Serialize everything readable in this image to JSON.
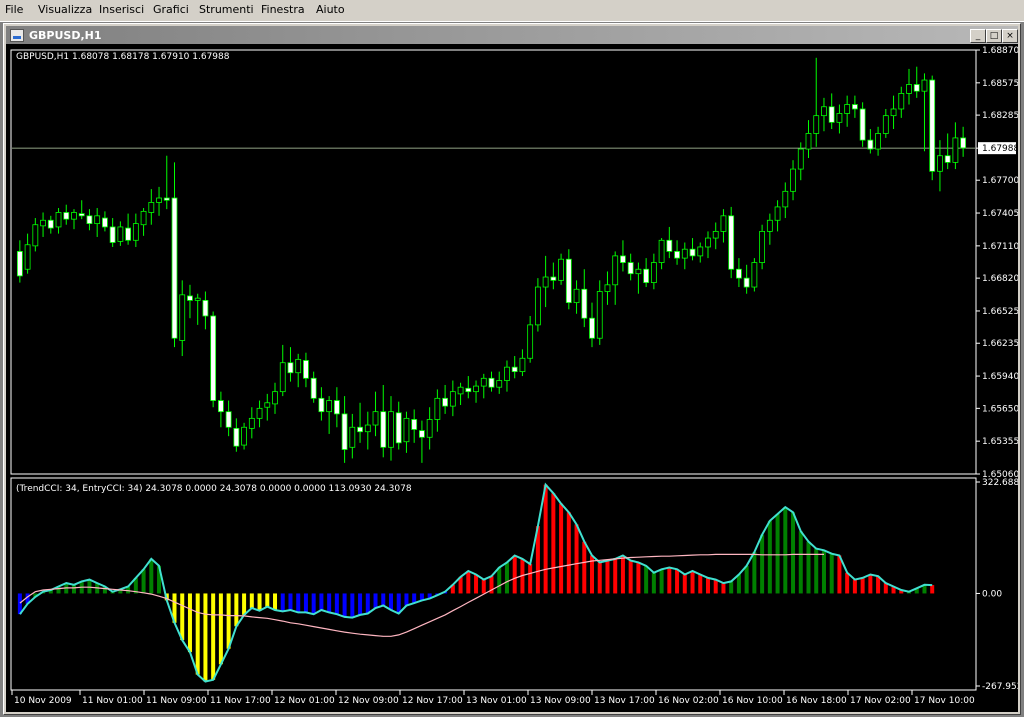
{
  "menu": [
    "File",
    "Visualizza",
    "Inserisci",
    "Grafici",
    "Strumenti",
    "Finestra",
    "Aiuto"
  ],
  "window": {
    "title": "GBPUSD,H1",
    "min_glyph": "_",
    "max_glyph": "□",
    "close_glyph": "×"
  },
  "colors": {
    "bull_candle": "#00ff00",
    "bear_candle": "#00ff00",
    "bull_body": "#000000",
    "bear_body": "#ffffff",
    "hist_green": "#008000",
    "hist_red": "#ff0000",
    "hist_blue": "#0000ff",
    "hist_yellow": "#ffff00",
    "cci_line": "#40e0d0",
    "entry_line": "#ffb6c1",
    "price_line": "#c0d8b0"
  },
  "price_chart": {
    "header": "GBPUSD,H1  1.68078 1.68178 1.67910 1.67988",
    "current_price": "1.67988",
    "price_ticks": [
      "1.68870",
      "1.68575",
      "1.68285",
      "1.67988",
      "1.67700",
      "1.67405",
      "1.67110",
      "1.66820",
      "1.66525",
      "1.66235",
      "1.65940",
      "1.65650",
      "1.65355",
      "1.65060"
    ]
  },
  "indicator": {
    "header": "(TrendCCI: 34, EntryCCI: 34)  24.3078 0.0000 24.3078 0.0000 0.0000 113.0930 24.3078",
    "ticks": [
      "322.6887",
      "0.00",
      "-267.9521"
    ]
  },
  "time_axis": [
    "10 Nov 2009",
    "11 Nov 01:00",
    "11 Nov 09:00",
    "11 Nov 17:00",
    "12 Nov 01:00",
    "12 Nov 09:00",
    "12 Nov 17:00",
    "13 Nov 01:00",
    "13 Nov 09:00",
    "13 Nov 17:00",
    "16 Nov 02:00",
    "16 Nov 10:00",
    "16 Nov 18:00",
    "17 Nov 02:00",
    "17 Nov 10:00"
  ],
  "chart_data": {
    "type": "candlestick",
    "symbol": "GBPUSD",
    "timeframe": "H1",
    "ylim": [
      1.6506,
      1.6887
    ],
    "candles": [
      {
        "o": 1.6706,
        "h": 1.6716,
        "l": 1.6678,
        "c": 1.6684
      },
      {
        "o": 1.669,
        "h": 1.6722,
        "l": 1.6686,
        "c": 1.6712
      },
      {
        "o": 1.6711,
        "h": 1.6736,
        "l": 1.6706,
        "c": 1.673
      },
      {
        "o": 1.6729,
        "h": 1.6741,
        "l": 1.6719,
        "c": 1.6734
      },
      {
        "o": 1.6734,
        "h": 1.6738,
        "l": 1.6722,
        "c": 1.6727
      },
      {
        "o": 1.6728,
        "h": 1.6745,
        "l": 1.6722,
        "c": 1.6741
      },
      {
        "o": 1.6741,
        "h": 1.6748,
        "l": 1.673,
        "c": 1.6735
      },
      {
        "o": 1.6735,
        "h": 1.6744,
        "l": 1.6726,
        "c": 1.6741
      },
      {
        "o": 1.674,
        "h": 1.6752,
        "l": 1.6735,
        "c": 1.6738
      },
      {
        "o": 1.6738,
        "h": 1.6744,
        "l": 1.6725,
        "c": 1.6731
      },
      {
        "o": 1.6731,
        "h": 1.6745,
        "l": 1.6719,
        "c": 1.6738
      },
      {
        "o": 1.6736,
        "h": 1.6742,
        "l": 1.6724,
        "c": 1.6728
      },
      {
        "o": 1.6728,
        "h": 1.6736,
        "l": 1.671,
        "c": 1.6714
      },
      {
        "o": 1.6715,
        "h": 1.6733,
        "l": 1.6711,
        "c": 1.6728
      },
      {
        "o": 1.6727,
        "h": 1.674,
        "l": 1.6712,
        "c": 1.6716
      },
      {
        "o": 1.6716,
        "h": 1.674,
        "l": 1.671,
        "c": 1.6731
      },
      {
        "o": 1.673,
        "h": 1.6745,
        "l": 1.672,
        "c": 1.6742
      },
      {
        "o": 1.6741,
        "h": 1.6762,
        "l": 1.673,
        "c": 1.675
      },
      {
        "o": 1.675,
        "h": 1.6764,
        "l": 1.6738,
        "c": 1.6754
      },
      {
        "o": 1.6754,
        "h": 1.6792,
        "l": 1.6744,
        "c": 1.6752
      },
      {
        "o": 1.6754,
        "h": 1.6786,
        "l": 1.662,
        "c": 1.6628
      },
      {
        "o": 1.6626,
        "h": 1.668,
        "l": 1.6612,
        "c": 1.6667
      },
      {
        "o": 1.6666,
        "h": 1.6676,
        "l": 1.6646,
        "c": 1.6662
      },
      {
        "o": 1.6662,
        "h": 1.6668,
        "l": 1.664,
        "c": 1.6664
      },
      {
        "o": 1.6662,
        "h": 1.667,
        "l": 1.6636,
        "c": 1.6648
      },
      {
        "o": 1.6648,
        "h": 1.6652,
        "l": 1.6566,
        "c": 1.6572
      },
      {
        "o": 1.6572,
        "h": 1.658,
        "l": 1.6548,
        "c": 1.6562
      },
      {
        "o": 1.6562,
        "h": 1.6572,
        "l": 1.654,
        "c": 1.6548
      },
      {
        "o": 1.6547,
        "h": 1.6556,
        "l": 1.6526,
        "c": 1.6531
      },
      {
        "o": 1.6532,
        "h": 1.6552,
        "l": 1.6528,
        "c": 1.6548
      },
      {
        "o": 1.6547,
        "h": 1.6566,
        "l": 1.6538,
        "c": 1.6556
      },
      {
        "o": 1.6556,
        "h": 1.6572,
        "l": 1.6548,
        "c": 1.6565
      },
      {
        "o": 1.6566,
        "h": 1.6578,
        "l": 1.6554,
        "c": 1.657
      },
      {
        "o": 1.6569,
        "h": 1.6588,
        "l": 1.656,
        "c": 1.658
      },
      {
        "o": 1.658,
        "h": 1.6622,
        "l": 1.6576,
        "c": 1.6606
      },
      {
        "o": 1.6606,
        "h": 1.662,
        "l": 1.6589,
        "c": 1.6597
      },
      {
        "o": 1.6597,
        "h": 1.6614,
        "l": 1.6584,
        "c": 1.6609
      },
      {
        "o": 1.6608,
        "h": 1.6615,
        "l": 1.6584,
        "c": 1.6592
      },
      {
        "o": 1.6592,
        "h": 1.6598,
        "l": 1.657,
        "c": 1.6574
      },
      {
        "o": 1.6574,
        "h": 1.6584,
        "l": 1.6554,
        "c": 1.6562
      },
      {
        "o": 1.6562,
        "h": 1.6576,
        "l": 1.6542,
        "c": 1.6572
      },
      {
        "o": 1.6572,
        "h": 1.6584,
        "l": 1.6548,
        "c": 1.656
      },
      {
        "o": 1.656,
        "h": 1.6576,
        "l": 1.6516,
        "c": 1.6528
      },
      {
        "o": 1.653,
        "h": 1.656,
        "l": 1.652,
        "c": 1.6548
      },
      {
        "o": 1.6548,
        "h": 1.657,
        "l": 1.6534,
        "c": 1.6544
      },
      {
        "o": 1.6544,
        "h": 1.6562,
        "l": 1.6528,
        "c": 1.655
      },
      {
        "o": 1.655,
        "h": 1.658,
        "l": 1.654,
        "c": 1.6562
      },
      {
        "o": 1.6562,
        "h": 1.6586,
        "l": 1.6521,
        "c": 1.653
      },
      {
        "o": 1.653,
        "h": 1.6576,
        "l": 1.6518,
        "c": 1.6562
      },
      {
        "o": 1.6561,
        "h": 1.6571,
        "l": 1.6528,
        "c": 1.6534
      },
      {
        "o": 1.6535,
        "h": 1.6562,
        "l": 1.6525,
        "c": 1.6556
      },
      {
        "o": 1.6555,
        "h": 1.6564,
        "l": 1.6534,
        "c": 1.6546
      },
      {
        "o": 1.6545,
        "h": 1.6554,
        "l": 1.6516,
        "c": 1.6539
      },
      {
        "o": 1.6539,
        "h": 1.6566,
        "l": 1.6528,
        "c": 1.6555
      },
      {
        "o": 1.6555,
        "h": 1.6582,
        "l": 1.6544,
        "c": 1.6574
      },
      {
        "o": 1.6574,
        "h": 1.6586,
        "l": 1.656,
        "c": 1.6567
      },
      {
        "o": 1.6567,
        "h": 1.659,
        "l": 1.6558,
        "c": 1.658
      },
      {
        "o": 1.6578,
        "h": 1.6588,
        "l": 1.6568,
        "c": 1.6584
      },
      {
        "o": 1.6583,
        "h": 1.6594,
        "l": 1.6574,
        "c": 1.658
      },
      {
        "o": 1.658,
        "h": 1.659,
        "l": 1.657,
        "c": 1.6585
      },
      {
        "o": 1.6585,
        "h": 1.6596,
        "l": 1.6574,
        "c": 1.6592
      },
      {
        "o": 1.6592,
        "h": 1.6598,
        "l": 1.658,
        "c": 1.6584
      },
      {
        "o": 1.6584,
        "h": 1.6598,
        "l": 1.6578,
        "c": 1.659
      },
      {
        "o": 1.659,
        "h": 1.6608,
        "l": 1.658,
        "c": 1.6602
      },
      {
        "o": 1.6602,
        "h": 1.6612,
        "l": 1.6592,
        "c": 1.6598
      },
      {
        "o": 1.6598,
        "h": 1.6618,
        "l": 1.6594,
        "c": 1.661
      },
      {
        "o": 1.661,
        "h": 1.6648,
        "l": 1.6606,
        "c": 1.664
      },
      {
        "o": 1.664,
        "h": 1.6682,
        "l": 1.6634,
        "c": 1.6674
      },
      {
        "o": 1.6674,
        "h": 1.6702,
        "l": 1.6656,
        "c": 1.6683
      },
      {
        "o": 1.6683,
        "h": 1.6696,
        "l": 1.6672,
        "c": 1.668
      },
      {
        "o": 1.668,
        "h": 1.6704,
        "l": 1.6676,
        "c": 1.6699
      },
      {
        "o": 1.6699,
        "h": 1.6708,
        "l": 1.6654,
        "c": 1.666
      },
      {
        "o": 1.666,
        "h": 1.668,
        "l": 1.665,
        "c": 1.6672
      },
      {
        "o": 1.6672,
        "h": 1.669,
        "l": 1.6638,
        "c": 1.6646
      },
      {
        "o": 1.6646,
        "h": 1.666,
        "l": 1.662,
        "c": 1.6628
      },
      {
        "o": 1.6628,
        "h": 1.668,
        "l": 1.6622,
        "c": 1.667
      },
      {
        "o": 1.667,
        "h": 1.6688,
        "l": 1.6658,
        "c": 1.6676
      },
      {
        "o": 1.6676,
        "h": 1.6706,
        "l": 1.6658,
        "c": 1.6702
      },
      {
        "o": 1.6702,
        "h": 1.6716,
        "l": 1.6688,
        "c": 1.6696
      },
      {
        "o": 1.6696,
        "h": 1.6704,
        "l": 1.668,
        "c": 1.6686
      },
      {
        "o": 1.6686,
        "h": 1.6696,
        "l": 1.6668,
        "c": 1.669
      },
      {
        "o": 1.669,
        "h": 1.67,
        "l": 1.6674,
        "c": 1.6678
      },
      {
        "o": 1.6678,
        "h": 1.6704,
        "l": 1.6672,
        "c": 1.6696
      },
      {
        "o": 1.6696,
        "h": 1.6718,
        "l": 1.669,
        "c": 1.6716
      },
      {
        "o": 1.6716,
        "h": 1.6728,
        "l": 1.67,
        "c": 1.6706
      },
      {
        "o": 1.6706,
        "h": 1.6716,
        "l": 1.6694,
        "c": 1.67
      },
      {
        "o": 1.67,
        "h": 1.6714,
        "l": 1.669,
        "c": 1.6708
      },
      {
        "o": 1.6708,
        "h": 1.6718,
        "l": 1.6698,
        "c": 1.6702
      },
      {
        "o": 1.6702,
        "h": 1.6714,
        "l": 1.6696,
        "c": 1.671
      },
      {
        "o": 1.671,
        "h": 1.6724,
        "l": 1.67,
        "c": 1.6718
      },
      {
        "o": 1.6718,
        "h": 1.6732,
        "l": 1.6708,
        "c": 1.6724
      },
      {
        "o": 1.6724,
        "h": 1.6744,
        "l": 1.6714,
        "c": 1.6738
      },
      {
        "o": 1.6738,
        "h": 1.6746,
        "l": 1.6682,
        "c": 1.669
      },
      {
        "o": 1.669,
        "h": 1.67,
        "l": 1.6674,
        "c": 1.6682
      },
      {
        "o": 1.6682,
        "h": 1.6694,
        "l": 1.6668,
        "c": 1.6674
      },
      {
        "o": 1.6674,
        "h": 1.67,
        "l": 1.667,
        "c": 1.6696
      },
      {
        "o": 1.6696,
        "h": 1.673,
        "l": 1.669,
        "c": 1.6724
      },
      {
        "o": 1.6724,
        "h": 1.674,
        "l": 1.6712,
        "c": 1.6734
      },
      {
        "o": 1.6734,
        "h": 1.6752,
        "l": 1.6724,
        "c": 1.6746
      },
      {
        "o": 1.6746,
        "h": 1.6768,
        "l": 1.6736,
        "c": 1.676
      },
      {
        "o": 1.676,
        "h": 1.6788,
        "l": 1.6752,
        "c": 1.678
      },
      {
        "o": 1.678,
        "h": 1.6804,
        "l": 1.677,
        "c": 1.6798
      },
      {
        "o": 1.6798,
        "h": 1.6824,
        "l": 1.679,
        "c": 1.6812
      },
      {
        "o": 1.6812,
        "h": 1.688,
        "l": 1.68,
        "c": 1.6828
      },
      {
        "o": 1.6828,
        "h": 1.6844,
        "l": 1.6814,
        "c": 1.6836
      },
      {
        "o": 1.6836,
        "h": 1.6848,
        "l": 1.6816,
        "c": 1.6822
      },
      {
        "o": 1.6822,
        "h": 1.6838,
        "l": 1.6812,
        "c": 1.683
      },
      {
        "o": 1.683,
        "h": 1.6846,
        "l": 1.6818,
        "c": 1.6838
      },
      {
        "o": 1.6838,
        "h": 1.6846,
        "l": 1.6826,
        "c": 1.6834
      },
      {
        "o": 1.6834,
        "h": 1.684,
        "l": 1.68,
        "c": 1.6806
      },
      {
        "o": 1.6806,
        "h": 1.6816,
        "l": 1.6794,
        "c": 1.6798
      },
      {
        "o": 1.6798,
        "h": 1.6818,
        "l": 1.6792,
        "c": 1.6812
      },
      {
        "o": 1.6812,
        "h": 1.6834,
        "l": 1.6808,
        "c": 1.6828
      },
      {
        "o": 1.6828,
        "h": 1.6846,
        "l": 1.6816,
        "c": 1.6834
      },
      {
        "o": 1.6834,
        "h": 1.6854,
        "l": 1.6826,
        "c": 1.6848
      },
      {
        "o": 1.6848,
        "h": 1.687,
        "l": 1.6838,
        "c": 1.6856
      },
      {
        "o": 1.6856,
        "h": 1.6872,
        "l": 1.6844,
        "c": 1.685
      },
      {
        "o": 1.685,
        "h": 1.6866,
        "l": 1.6796,
        "c": 1.686
      },
      {
        "o": 1.686,
        "h": 1.6864,
        "l": 1.677,
        "c": 1.6778
      },
      {
        "o": 1.6778,
        "h": 1.6806,
        "l": 1.676,
        "c": 1.6792
      },
      {
        "o": 1.6792,
        "h": 1.6812,
        "l": 1.678,
        "c": 1.6786
      },
      {
        "o": 1.6786,
        "h": 1.6822,
        "l": 1.678,
        "c": 1.6808
      },
      {
        "o": 1.6808,
        "h": 1.6818,
        "l": 1.6791,
        "c": 1.6799
      }
    ],
    "indicator": {
      "name": "TrendCCI",
      "ylim": [
        -267.9521,
        322.6887
      ],
      "values": [
        -60,
        -30,
        -10,
        5,
        10,
        20,
        30,
        25,
        35,
        40,
        30,
        20,
        5,
        12,
        20,
        45,
        70,
        100,
        80,
        -20,
        -85,
        -135,
        -170,
        -235,
        -255,
        -250,
        -205,
        -160,
        -95,
        -62,
        -42,
        -50,
        -38,
        -48,
        -52,
        -48,
        -55,
        -55,
        -60,
        -48,
        -55,
        -60,
        -68,
        -70,
        -62,
        -58,
        -42,
        -35,
        -48,
        -58,
        -35,
        -28,
        -20,
        -15,
        -5,
        5,
        25,
        48,
        65,
        55,
        40,
        50,
        75,
        90,
        110,
        100,
        85,
        195,
        315,
        290,
        260,
        235,
        200,
        150,
        110,
        90,
        95,
        100,
        110,
        95,
        90,
        80,
        60,
        70,
        75,
        70,
        55,
        65,
        55,
        45,
        40,
        30,
        35,
        55,
        80,
        120,
        170,
        210,
        230,
        250,
        235,
        180,
        150,
        130,
        125,
        115,
        110,
        60,
        40,
        45,
        55,
        50,
        30,
        20,
        10,
        5,
        15,
        25,
        24.3078
      ],
      "color_segments": [
        "blue:0-1",
        "green:2-18",
        "yellow:19-33",
        "blue:34-55",
        "red:56-61",
        "green:62-63",
        "red:64-80",
        "green:81-83",
        "red:84-91",
        "green:92-105",
        "red:106-114",
        "green:115-117",
        "red:118-121"
      ],
      "entry_line": [
        -28,
        -10,
        5,
        10,
        12,
        14,
        16,
        16,
        18,
        18,
        16,
        14,
        12,
        10,
        8,
        5,
        2,
        -2,
        -8,
        -15,
        -25,
        -35,
        -45,
        -55,
        -60,
        -62,
        -62,
        -64,
        -64,
        -65,
        -68,
        -70,
        -72,
        -76,
        -80,
        -85,
        -88,
        -92,
        -96,
        -100,
        -104,
        -108,
        -112,
        -115,
        -118,
        -120,
        -122,
        -124,
        -124,
        -120,
        -112,
        -102,
        -92,
        -82,
        -72,
        -62,
        -50,
        -38,
        -26,
        -14,
        -2,
        10,
        22,
        34,
        44,
        52,
        58,
        64,
        70,
        74,
        78,
        82,
        86,
        90,
        94,
        96,
        98,
        100,
        102,
        104,
        105,
        106,
        107,
        108,
        108,
        109,
        110,
        111,
        112,
        112,
        113,
        113,
        113,
        113,
        113,
        113,
        112,
        112,
        112,
        112,
        113,
        113,
        113,
        113,
        113.093
      ]
    }
  }
}
